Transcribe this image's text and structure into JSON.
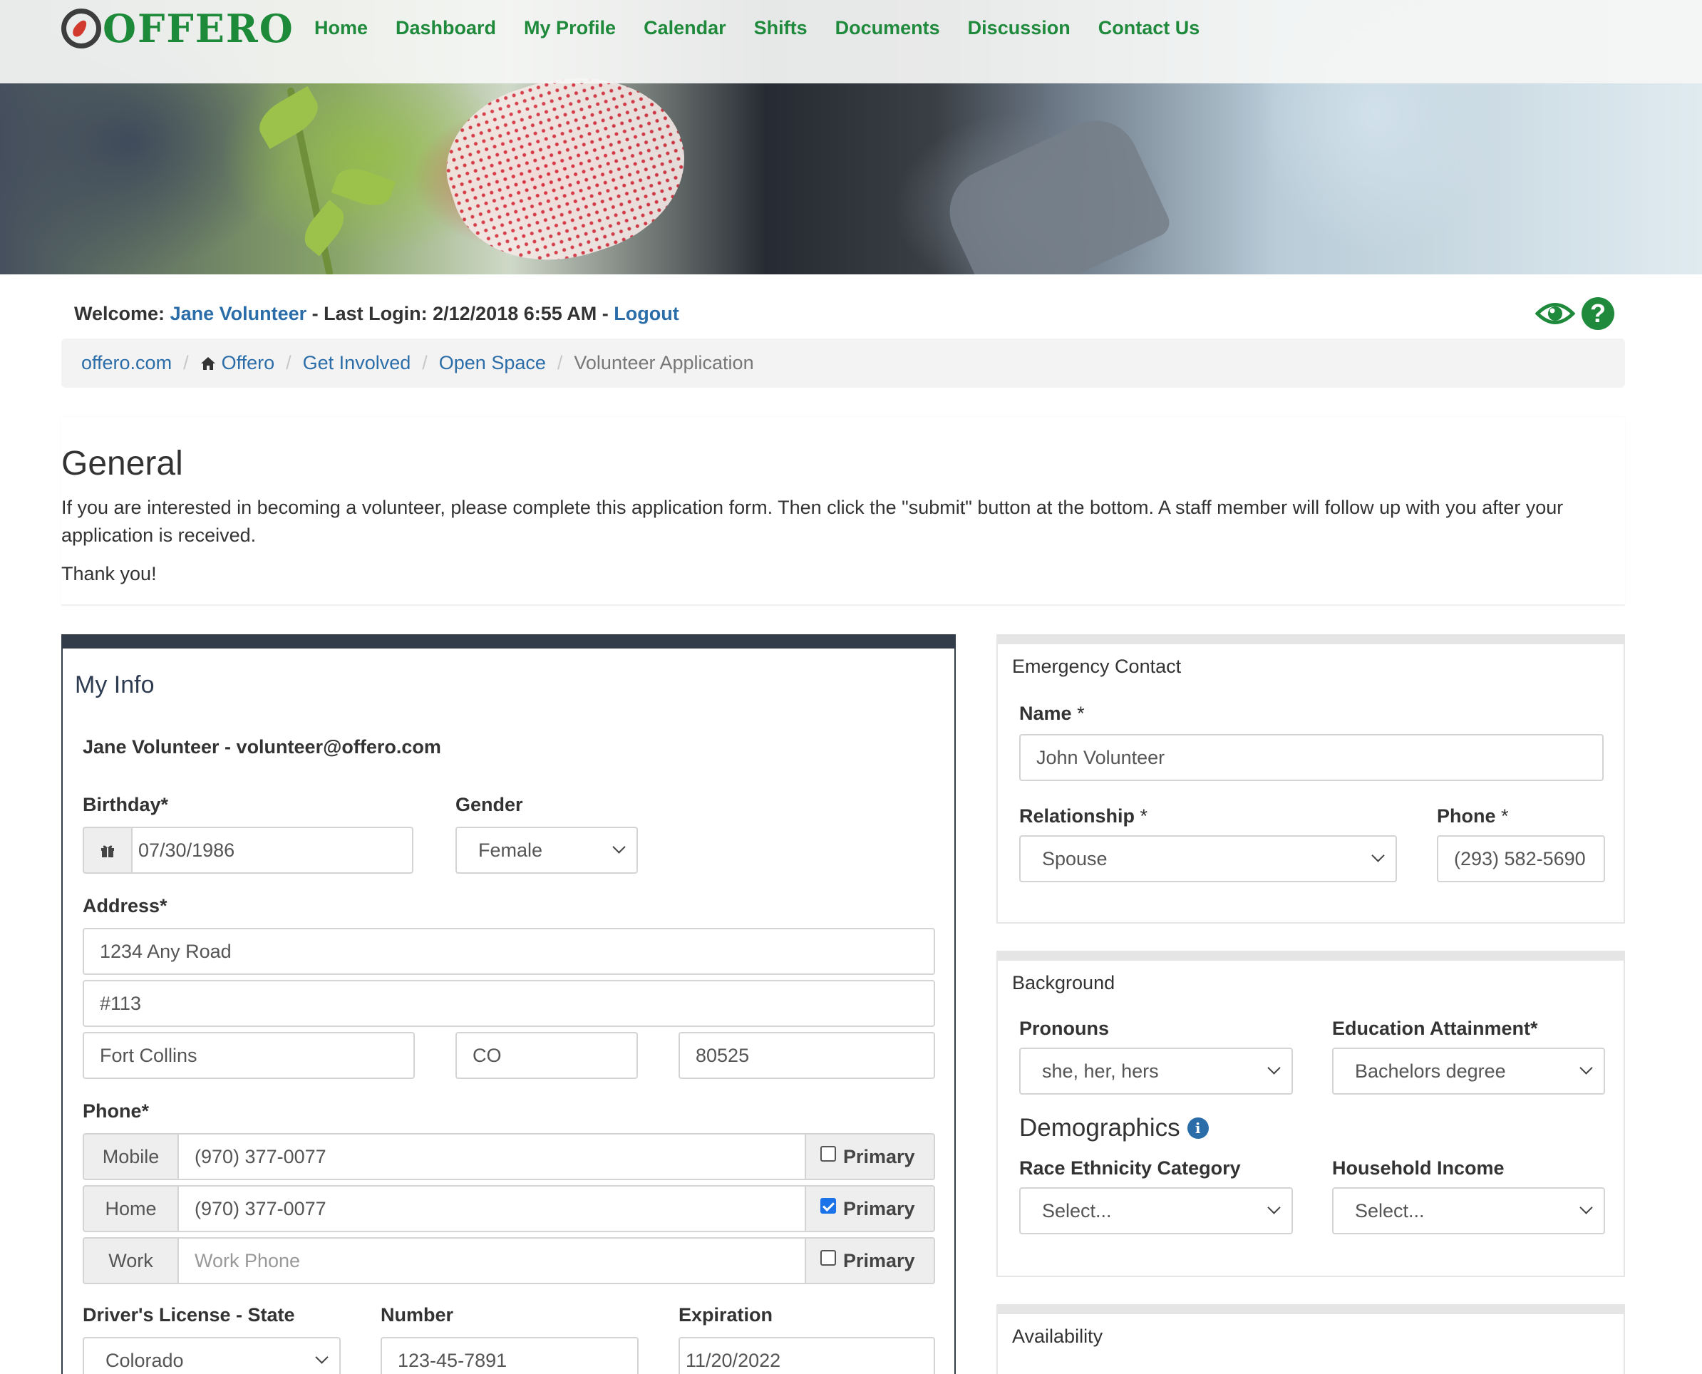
{
  "brand": {
    "name": "OFFERO"
  },
  "nav": [
    "Home",
    "Dashboard",
    "My Profile",
    "Calendar",
    "Shifts",
    "Documents",
    "Discussion",
    "Contact Us"
  ],
  "welcome": {
    "prefix": "Welcome:",
    "user": "Jane Volunteer",
    "mid": "- Last Login: 2/12/2018 6:55 AM -",
    "logout": "Logout"
  },
  "icons": {
    "eye": "eye-icon",
    "help": "question-circle-icon",
    "help_glyph": "?",
    "home": "home-icon",
    "gift": "gift-icon",
    "info": "info-icon",
    "info_glyph": "i",
    "accent": "#1f8a3c",
    "link": "#2b6da8"
  },
  "breadcrumb": [
    {
      "label": "offero.com"
    },
    {
      "label": "Offero"
    },
    {
      "label": "Get Involved"
    },
    {
      "label": "Open Space"
    },
    {
      "label": "Volunteer Application"
    }
  ],
  "general": {
    "title": "General",
    "intro": "If you are interested in becoming a volunteer, please complete this application form. Then click the \"submit\" button at the bottom. A staff member will follow up with you after your application is received.",
    "thanks": "Thank you!"
  },
  "my_info": {
    "title": "My Info",
    "user_line": "Jane Volunteer - volunteer@offero.com",
    "birthday_label": "Birthday*",
    "birthday": "07/30/1986",
    "gender_label": "Gender",
    "gender": "Female",
    "address_label": "Address*",
    "address1": "1234 Any Road",
    "address2": "#113",
    "city": "Fort Collins",
    "state": "CO",
    "zip": "80525",
    "phone_label": "Phone*",
    "phones": [
      {
        "type": "Mobile",
        "value": "(970) 377-0077",
        "placeholder": "",
        "primary_label": "Primary",
        "primary": false
      },
      {
        "type": "Home",
        "value": "(970) 377-0077",
        "placeholder": "",
        "primary_label": "Primary",
        "primary": true
      },
      {
        "type": "Work",
        "value": "",
        "placeholder": "Work Phone",
        "primary_label": "Primary",
        "primary": false
      }
    ],
    "dl_state_label": "Driver's License - State",
    "dl_state": "Colorado",
    "dl_number_label": "Number",
    "dl_number": "123-45-7891",
    "dl_exp_label": "Expiration",
    "dl_exp": "11/20/2022"
  },
  "emergency": {
    "title": "Emergency Contact",
    "name_label": "Name",
    "req": "*",
    "name": "John Volunteer",
    "relationship_label": "Relationship",
    "relationship": "Spouse",
    "phone_label": "Phone",
    "phone": "(293) 582-5690"
  },
  "background": {
    "title": "Background",
    "pronouns_label": "Pronouns",
    "pronouns": "she, her, hers",
    "education_label": "Education Attainment*",
    "education": "Bachelors degree",
    "demographics_title": "Demographics",
    "race_label": "Race Ethnicity Category",
    "race": "Select...",
    "income_label": "Household Income",
    "income": "Select..."
  },
  "availability": {
    "title": "Availability"
  }
}
